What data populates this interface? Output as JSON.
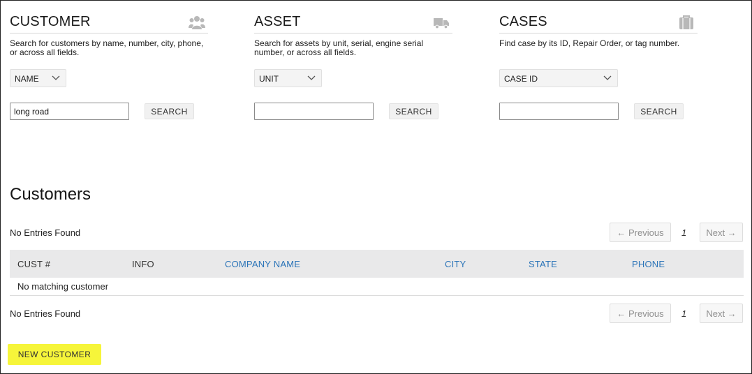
{
  "customer_panel": {
    "title": "CUSTOMER",
    "icon": "users-icon",
    "description": "Search for customers by name, number, city, phone, or across all fields.",
    "select_value": "NAME",
    "input_value": "long road",
    "search_label": "SEARCH"
  },
  "asset_panel": {
    "title": "ASSET",
    "icon": "truck-icon",
    "description": "Search for assets by unit, serial, engine serial number, or across all fields.",
    "select_value": "UNIT",
    "input_value": "",
    "search_label": "SEARCH"
  },
  "cases_panel": {
    "title": "CASES",
    "icon": "briefcase-icon",
    "description": "Find case by its ID, Repair Order, or tag number.",
    "select_value": "CASE ID",
    "input_value": "",
    "search_label": "SEARCH"
  },
  "customers": {
    "title": "Customers",
    "entries_top": "No Entries Found",
    "entries_bottom": "No Entries Found",
    "pager": {
      "previous_label": "← Previous",
      "page": "1",
      "next_label": "Next →"
    },
    "columns": [
      {
        "label": "CUST #",
        "sortable": false
      },
      {
        "label": "INFO",
        "sortable": false
      },
      {
        "label": "COMPANY NAME",
        "sortable": true
      },
      {
        "label": "CITY",
        "sortable": true
      },
      {
        "label": "STATE",
        "sortable": true
      },
      {
        "label": "PHONE",
        "sortable": true
      }
    ],
    "empty_message": "No matching customer",
    "new_button_label": "NEW CUSTOMER"
  },
  "colors": {
    "link": "#2b74b8",
    "header_bg": "#e9e9ea",
    "highlight": "#f6f53a",
    "icon_gray": "#b8b8b8"
  }
}
